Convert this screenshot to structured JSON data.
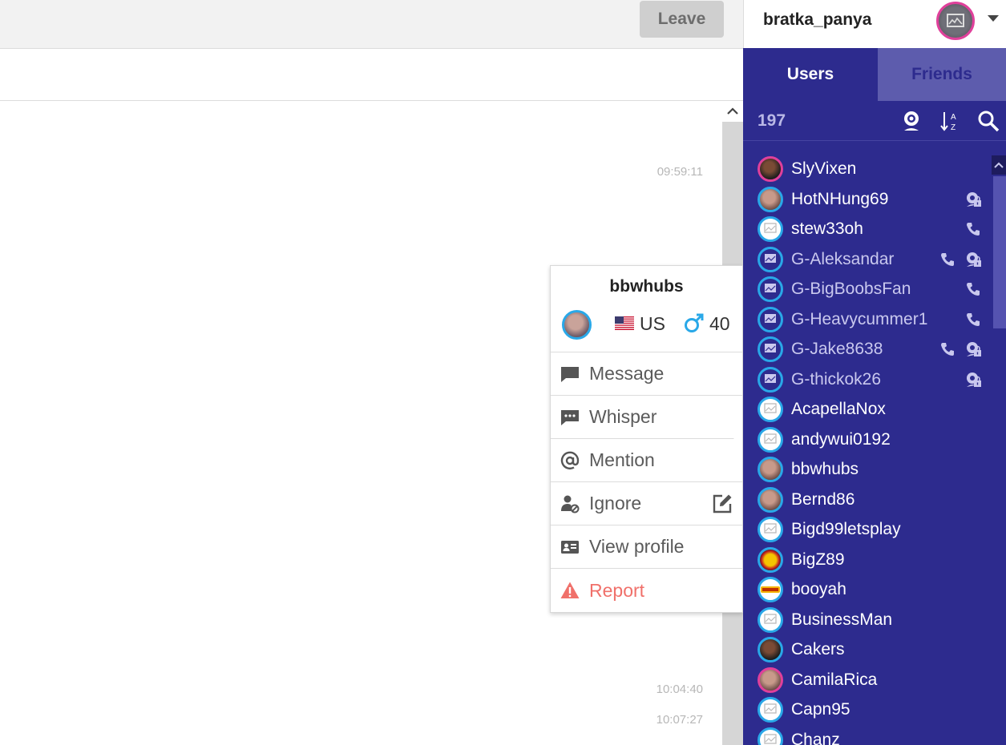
{
  "chat": {
    "leave_label": "Leave",
    "timestamps": [
      "09:59:11",
      "10:04:40",
      "10:07:27"
    ]
  },
  "popup": {
    "name": "bbwhubs",
    "country": "US",
    "age": "40",
    "menu": {
      "message": "Message",
      "whisper": "Whisper",
      "mention": "Mention",
      "ignore": "Ignore",
      "view_profile": "View profile",
      "report": "Report"
    }
  },
  "account": {
    "username": "bratka_panya"
  },
  "tabs": {
    "users": "Users",
    "friends": "Friends"
  },
  "toolbar": {
    "user_count": "197"
  },
  "users": [
    {
      "name": "SlyVixen"
    },
    {
      "name": "HotNHung69"
    },
    {
      "name": "stew33oh"
    },
    {
      "name": "G-Aleksandar"
    },
    {
      "name": "G-BigBoobsFan"
    },
    {
      "name": "G-Heavycummer1"
    },
    {
      "name": "G-Jake8638"
    },
    {
      "name": "G-thickok26"
    },
    {
      "name": "AcapellaNox"
    },
    {
      "name": "andywui0192"
    },
    {
      "name": "bbwhubs"
    },
    {
      "name": "Bernd86"
    },
    {
      "name": "Bigd99letsplay"
    },
    {
      "name": "BigZ89"
    },
    {
      "name": "booyah"
    },
    {
      "name": "BusinessMan"
    },
    {
      "name": "Cakers"
    },
    {
      "name": "CamilaRica"
    },
    {
      "name": "Capn95"
    },
    {
      "name": "Chanz"
    }
  ],
  "colors": {
    "sidebar_bg": "#2d2b8e",
    "tab_inactive_bg": "#5d5cad",
    "avatar_ring_blue": "#29a8e8",
    "avatar_ring_pink": "#e0409b",
    "report_red": "#f0706a",
    "leave_button_bg": "#cfcfcf"
  },
  "icons": {
    "toolbar": [
      "webcam-icon",
      "sort-az-icon",
      "search-icon"
    ],
    "menu": [
      "message-icon",
      "whisper-icon",
      "mention-icon",
      "ignore-icon",
      "view-profile-icon",
      "report-icon"
    ]
  }
}
